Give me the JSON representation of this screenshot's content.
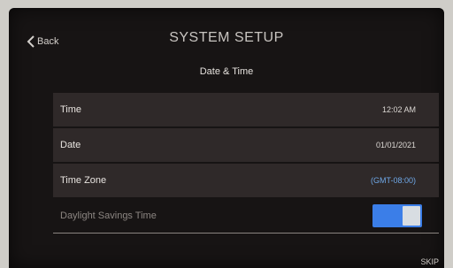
{
  "header": {
    "back_label": "Back",
    "title": "SYSTEM SETUP",
    "subtitle": "Date & Time"
  },
  "rows": [
    {
      "label": "Time",
      "value": "12:02 AM"
    },
    {
      "label": "Date",
      "value": "01/01/2021"
    },
    {
      "label": "Time Zone",
      "value_prefix": "(GMT-08:00)",
      "value_suffix": ""
    }
  ],
  "daylight": {
    "label": "Daylight Savings Time",
    "enabled": true
  },
  "footer": {
    "skip_label": "SKIP"
  },
  "colors": {
    "accent": "#3b7ee8",
    "background": "#171414",
    "row": "#2f2929"
  }
}
